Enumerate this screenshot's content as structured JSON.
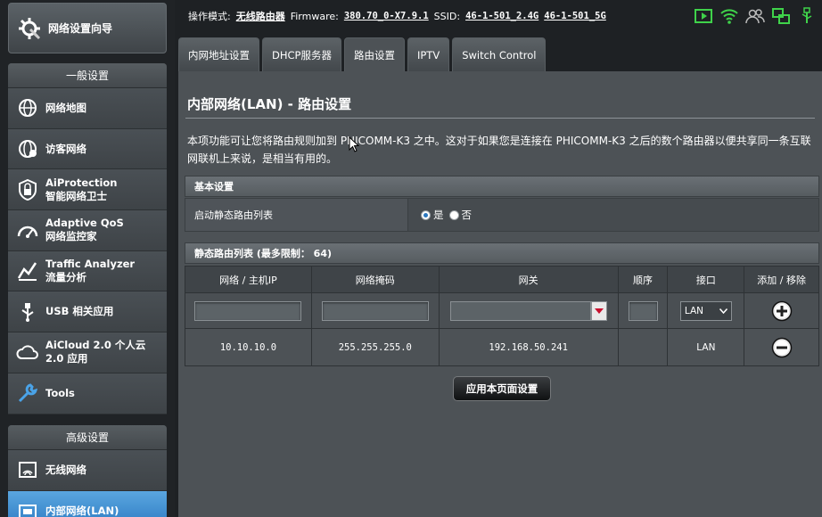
{
  "sidebar": {
    "wizard_label": "网络设置向导",
    "general_header": "一般设置",
    "general_items": [
      {
        "label": "网络地图",
        "icon": "globe-map-icon"
      },
      {
        "label": "访客网络",
        "icon": "guest-network-icon"
      },
      {
        "label": "AiProtection",
        "sublabel": "智能网络卫士",
        "icon": "shield-lock-icon"
      },
      {
        "label": "Adaptive QoS",
        "sublabel": "网络监控家",
        "icon": "gauge-icon"
      },
      {
        "label": "Traffic Analyzer",
        "sublabel": "流量分析",
        "icon": "chart-icon"
      },
      {
        "label": "USB 相关应用",
        "icon": "usb-icon"
      },
      {
        "label": "AiCloud 2.0 个人云",
        "sublabel": "2.0 应用",
        "icon": "cloud-icon"
      },
      {
        "label": "Tools",
        "icon": "wrench-icon"
      }
    ],
    "advanced_header": "高级设置",
    "advanced_items": [
      {
        "label": "无线网络",
        "icon": "wifi-icon"
      },
      {
        "label": "内部网络(LAN)",
        "icon": "lan-icon",
        "active": true
      }
    ]
  },
  "topbar": {
    "mode_label": "操作模式:",
    "mode_value": "无线路由器",
    "firmware_label": "Firmware:",
    "firmware_value": "380.70_0-X7.9.1",
    "ssid_label": "SSID:",
    "ssid_24": "46-1-501_2.4G",
    "ssid_5": "46-1-501_5G",
    "status_icons": [
      "play-icon",
      "wifi-status-icon",
      "users-icon",
      "network-status-icon",
      "usb-status-icon"
    ]
  },
  "tabs": [
    {
      "label": "内网地址设置"
    },
    {
      "label": "DHCP服务器"
    },
    {
      "label": "路由设置",
      "active": true
    },
    {
      "label": "IPTV"
    },
    {
      "label": "Switch Control"
    }
  ],
  "main": {
    "title": "内部网络(LAN) - 路由设置",
    "description": "本项功能可让您将路由规则加到 PHICOMM-K3 之中。这对于如果您是连接在 PHICOMM-K3 之后的数个路由器以便共享同一条互联网联机上来说，是相当有用的。",
    "basic_header": "基本设置",
    "static_route_label": "启动静态路由列表",
    "radio_yes": "是",
    "radio_no": "否",
    "list_header": "静态路由列表 (最多限制： 64)",
    "columns": [
      "网络 / 主机IP",
      "网络掩码",
      "网关",
      "顺序",
      "接口",
      "添加 / 移除"
    ],
    "new_interface": "LAN",
    "rows": [
      {
        "ip": "10.10.10.0",
        "mask": "255.255.255.0",
        "gateway": "192.168.50.241",
        "metric": "",
        "interface": "LAN"
      }
    ],
    "apply_button": "应用本页面设置"
  }
}
